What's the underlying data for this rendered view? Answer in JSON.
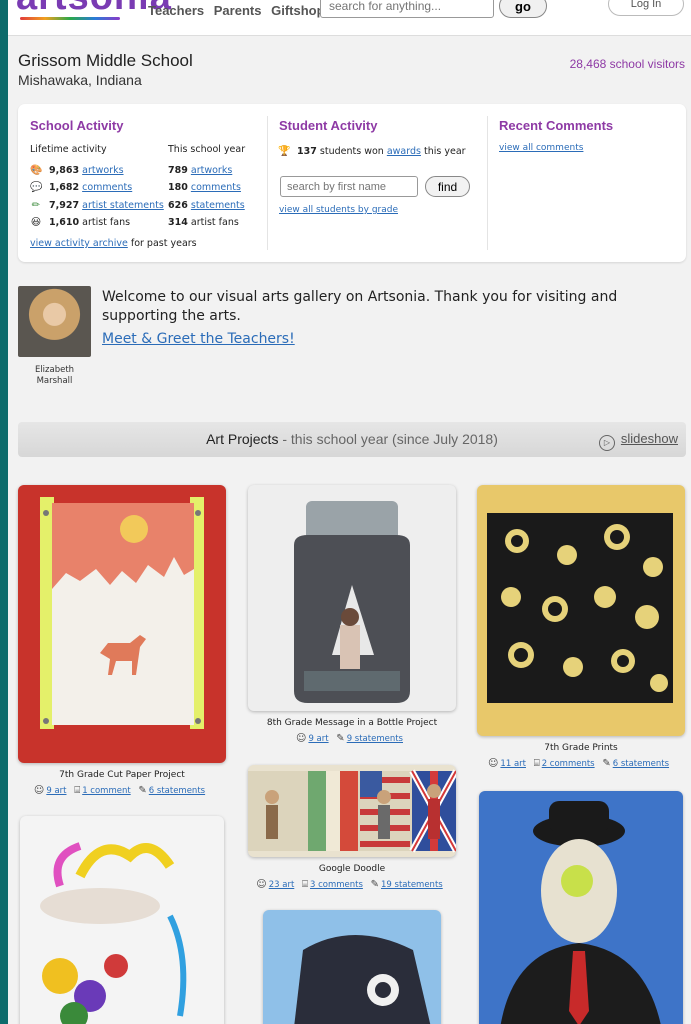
{
  "header": {
    "logo": "artsonia",
    "nav": [
      "Teachers",
      "Parents",
      "Giftshop"
    ],
    "search_placeholder": "search for anything...",
    "go_label": "go",
    "login_label": "Log In"
  },
  "school": {
    "name": "Grissom Middle School",
    "location": "Mishawaka, Indiana",
    "visitors": "28,468 school visitors"
  },
  "activity": {
    "school_title": "School Activity",
    "lifetime_label": "Lifetime activity",
    "year_label": "This school year",
    "rows": [
      {
        "icon": "palette-icon",
        "glyph": "🎨",
        "life_num": "9,863",
        "life_link": "artworks",
        "year_num": "789",
        "year_link": "artworks"
      },
      {
        "icon": "comment-icon",
        "glyph": "💬",
        "life_num": "1,682",
        "life_link": "comments",
        "year_num": "180",
        "year_link": "comments"
      },
      {
        "icon": "pencil-icon",
        "glyph": "✏",
        "life_num": "7,927",
        "life_link": "artist statements",
        "year_num": "626",
        "year_link": "statements"
      },
      {
        "icon": "smiley-icon",
        "glyph": "😃",
        "life_num": "1,610",
        "life_text": "artist fans",
        "year_num": "314",
        "year_text": "artist fans"
      }
    ],
    "archive_link": "view activity archive",
    "archive_suffix": "for past years",
    "student_title": "Student Activity",
    "awards_count": "137",
    "awards_pre": "students won",
    "awards_link": "awards",
    "awards_post": "this year",
    "name_placeholder": "search by first name",
    "find_label": "find",
    "grade_link": "view all students by grade",
    "comments_title": "Recent Comments",
    "comments_link": "view all comments"
  },
  "welcome": {
    "teacher_name": "Elizabeth Marshall",
    "message": "Welcome to our visual arts gallery on Artsonia. Thank you for visiting and supporting the arts.",
    "meet_link": "Meet & Greet the Teachers!"
  },
  "projects": {
    "heading": "Art Projects",
    "subheading": " - this school year (since July 2018)",
    "slideshow": "slideshow",
    "items": [
      {
        "title": "7th Grade Cut Paper Project",
        "art": "9 art",
        "comments": "1 comment",
        "statements": "6 statements"
      },
      {
        "title": "8th Grade Message in a Bottle Project",
        "art": "9 art",
        "statements": "9 statements"
      },
      {
        "title": "7th Grade Prints",
        "art": "11 art",
        "comments": "2 comments",
        "statements": "6 statements"
      },
      {
        "title": "Google Doodle",
        "art": "23 art",
        "comments": "3 comments",
        "statements": "19 statements"
      }
    ]
  }
}
